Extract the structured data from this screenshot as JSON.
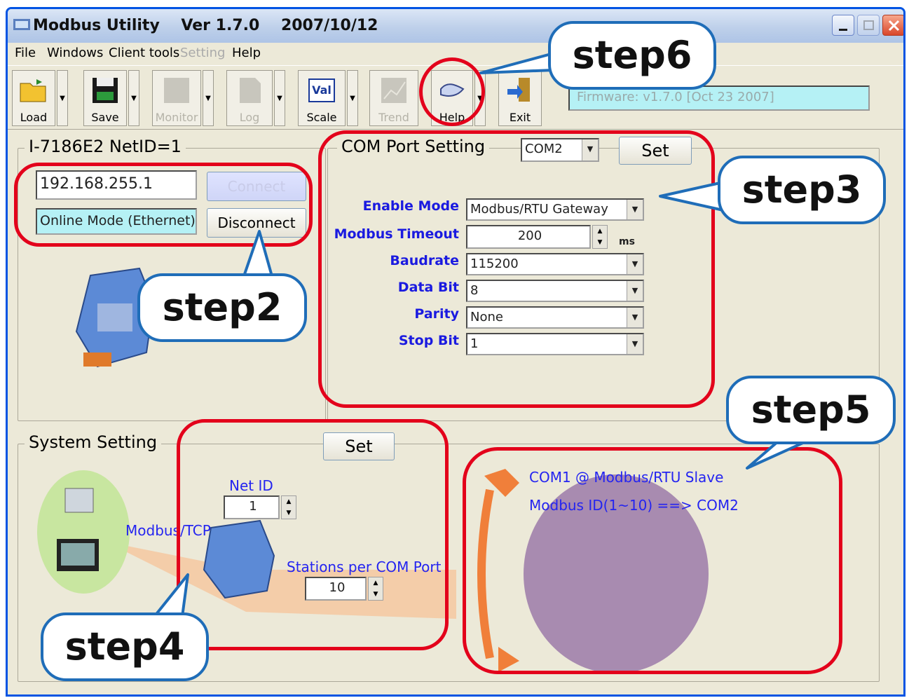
{
  "window": {
    "title": "Modbus Utility    Ver 1.7.0    2007/10/12"
  },
  "menu": {
    "items": [
      "File",
      "Windows",
      "Client tools",
      "Setting",
      "Help"
    ]
  },
  "toolbar": {
    "buttons": [
      "Load",
      "Save",
      "Monitor",
      "Log",
      "Scale",
      "Trend",
      "Help",
      "Exit"
    ],
    "scale_icon_text": "Val",
    "firmware": "Firmware:  v1.7.0  [Oct 23 2007]"
  },
  "device": {
    "group_title": "I-7186E2    NetID=1",
    "ip": "192.168.255.1",
    "connect_label": "Connect",
    "mode": "Online Mode (Ethernet)",
    "disconnect_label": "Disconnect"
  },
  "com_port": {
    "group_title": "COM Port Setting",
    "port": "COM2",
    "set_label": "Set",
    "enable_mode_label": "Enable Mode",
    "enable_mode": "Modbus/RTU Gateway",
    "timeout_label": "Modbus Timeout",
    "timeout": "200",
    "timeout_unit": "ms",
    "baudrate_label": "Baudrate",
    "baudrate": "115200",
    "databit_label": "Data Bit",
    "databit": "8",
    "parity_label": "Parity",
    "parity": "None",
    "stopbit_label": "Stop Bit",
    "stopbit": "1"
  },
  "system": {
    "group_title": "System Setting",
    "set_label": "Set",
    "netid_label": "Net ID",
    "netid": "1",
    "protocol_label": "Modbus/TCP",
    "stations_label": "Stations per COM Port",
    "stations": "10",
    "com1_text": "COM1  @ Modbus/RTU Slave",
    "modbus_id_text": "Modbus ID(1~10) ==> COM2"
  },
  "callouts": {
    "step2": "step2",
    "step3": "step3",
    "step4": "step4",
    "step5": "step5",
    "step6": "step6"
  },
  "colors": {
    "highlight": "#e3001b",
    "callout_border": "#1f6db8",
    "label_blue": "#1a1ae0",
    "firmware_bg": "#b5f1f5",
    "orange": "#f07f3a",
    "purple": "#a88bb0"
  }
}
